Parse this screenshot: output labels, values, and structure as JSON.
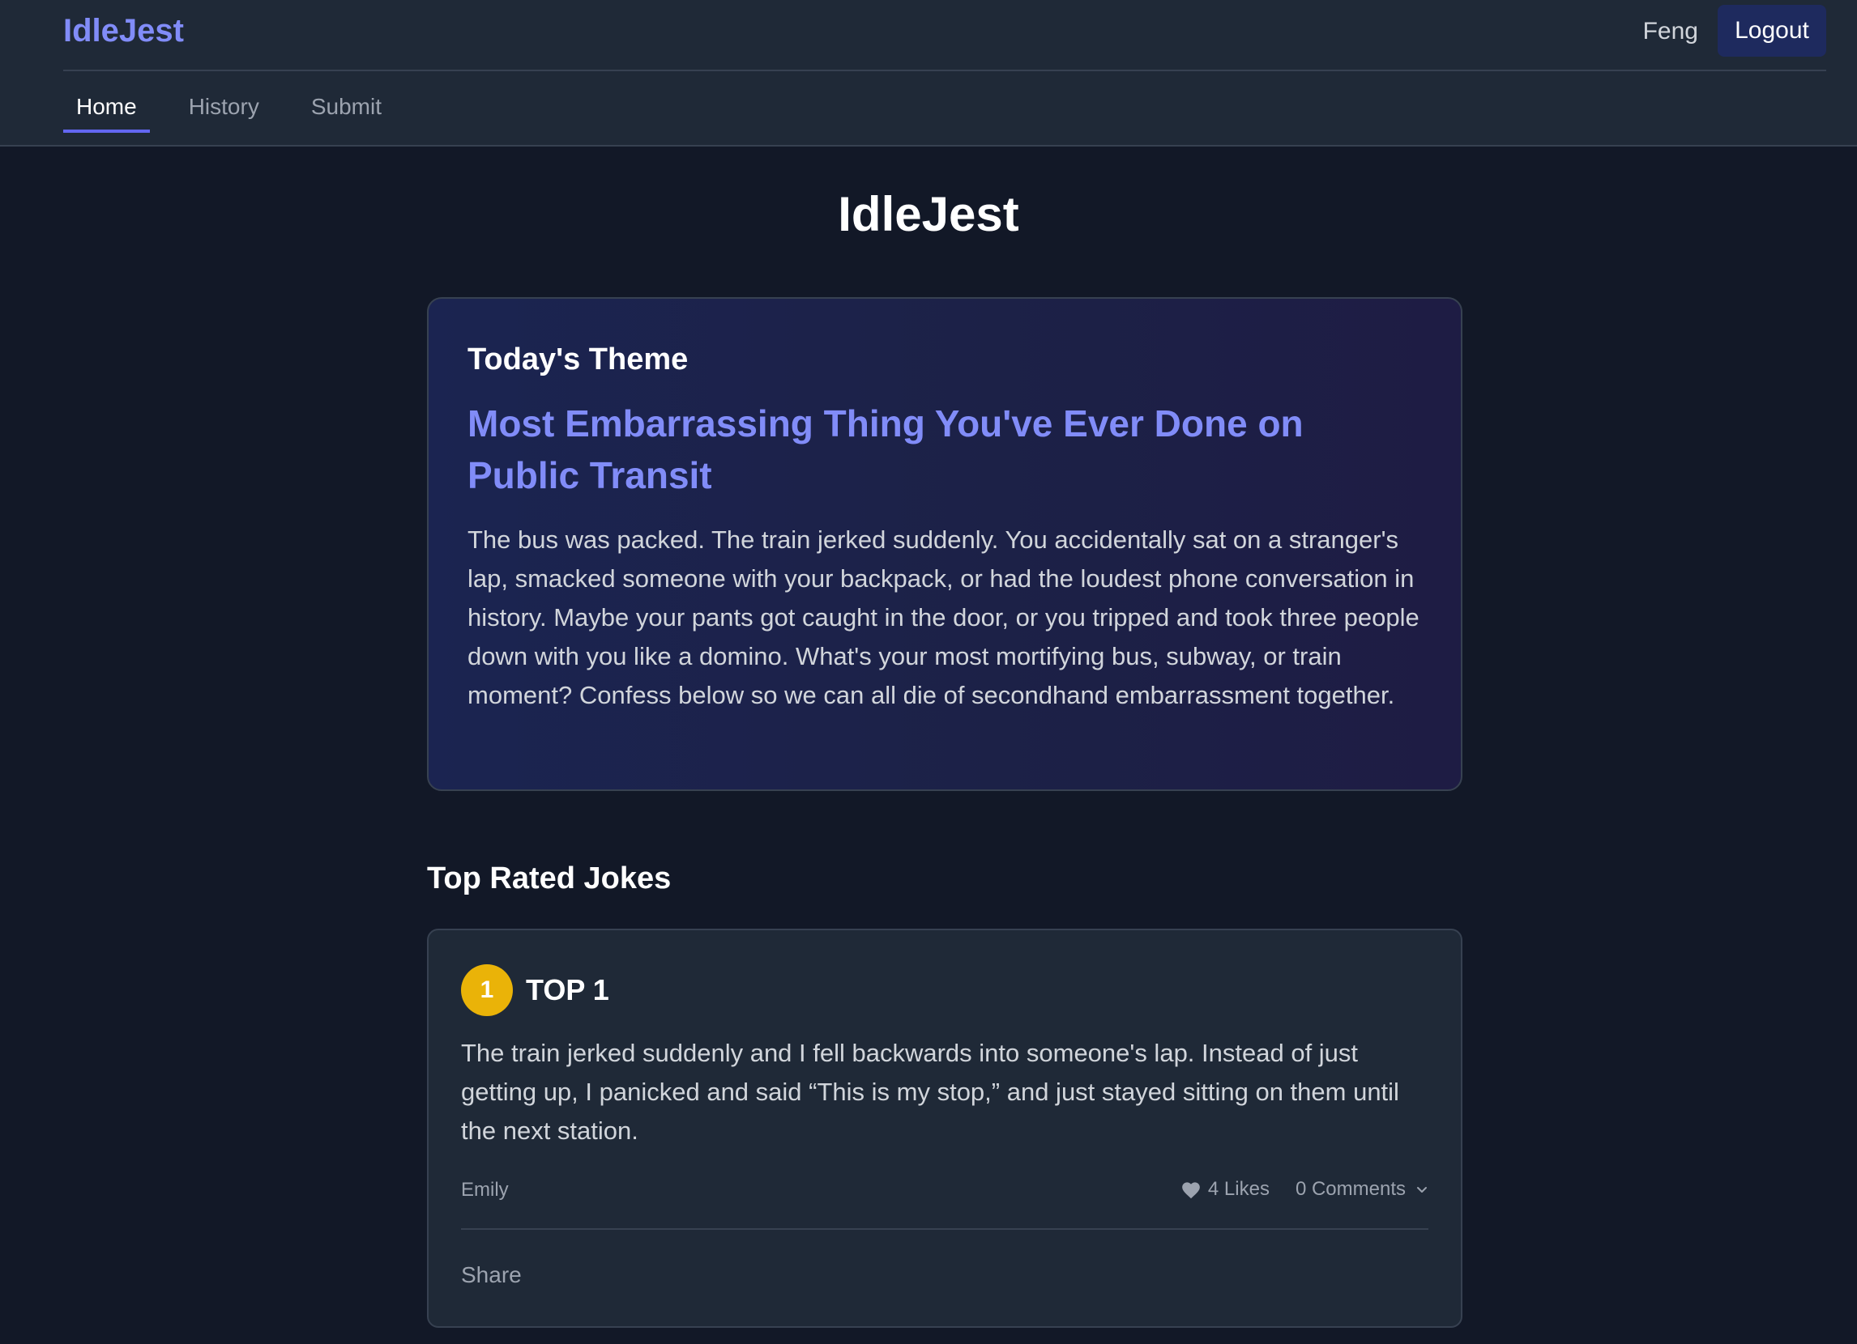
{
  "header": {
    "brand": "IdleJest",
    "user_name": "Feng",
    "logout_label": "Logout",
    "tabs": [
      {
        "label": "Home",
        "active": true
      },
      {
        "label": "History",
        "active": false
      },
      {
        "label": "Submit",
        "active": false
      }
    ]
  },
  "main": {
    "title": "IdleJest",
    "theme": {
      "label": "Today's Theme",
      "title": "Most Embarrassing Thing You've Ever Done on Public Transit",
      "description": "The bus was packed. The train jerked suddenly. You accidentally sat on a stranger's lap, smacked someone with your backpack, or had the loudest phone conversation in history. Maybe your pants got caught in the door, or you tripped and took three people down with you like a domino. What's your most mortifying bus, subway, or train moment? Confess below so we can all die of secondhand embarrassment together."
    },
    "top_rated": {
      "title": "Top Rated Jokes",
      "jokes": [
        {
          "rank": "1",
          "rank_label": "TOP 1",
          "text": "The train jerked suddenly and I fell backwards into someone's lap. Instead of just getting up, I panicked and said “This is my stop,” and just stayed sitting on them until the next station.",
          "author": "Emily",
          "likes": "4 Likes",
          "comments": "0 Comments",
          "share_label": "Share"
        }
      ]
    }
  },
  "colors": {
    "accent": "#818cf8",
    "tab_underline": "#6366f1",
    "rank_gold": "#eab308",
    "background": "#121827",
    "surface": "#1f2937"
  },
  "icons": {
    "likes": "heart-icon",
    "comments": "chevron-down-icon"
  }
}
